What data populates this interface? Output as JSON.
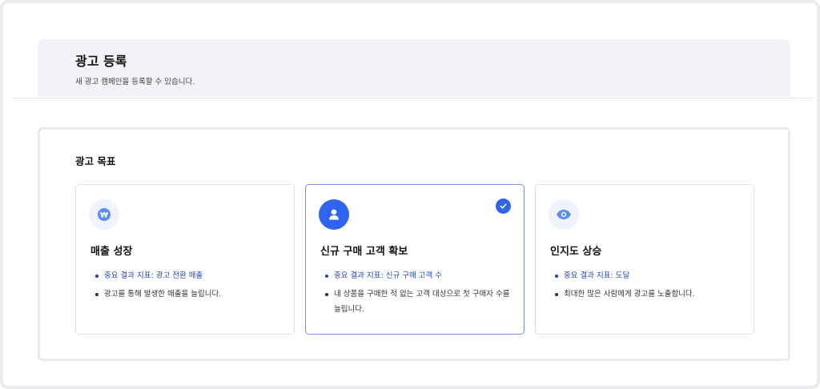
{
  "header": {
    "title": "광고 등록",
    "subtitle": "새 광고 캠페인을 등록할 수 있습니다."
  },
  "objective": {
    "section_title": "광고 목표",
    "selected_index": 1,
    "cards": [
      {
        "icon": "won-icon",
        "title": "매출 성장",
        "kpi": "중요 결과 지표: 광고 전환 매출",
        "description": "광고를 통해 발생한 매출을 늘립니다."
      },
      {
        "icon": "user-icon",
        "title": "신규 구매 고객 확보",
        "kpi": "중요 결과 지표: 신규 구매 고객 수",
        "description": "내 상품을 구매한 적 없는 고객 대상으로 첫 구매자 수를 늘립니다."
      },
      {
        "icon": "eye-icon",
        "title": "인지도 상승",
        "kpi": "중요 결과 지표: 도달",
        "description": "최대한 많은 사람에게 광고를 노출합니다."
      }
    ]
  },
  "colors": {
    "accent": "#2f64f0",
    "kpi_text": "#1f46c0",
    "header_bg": "#f1f3f6"
  }
}
